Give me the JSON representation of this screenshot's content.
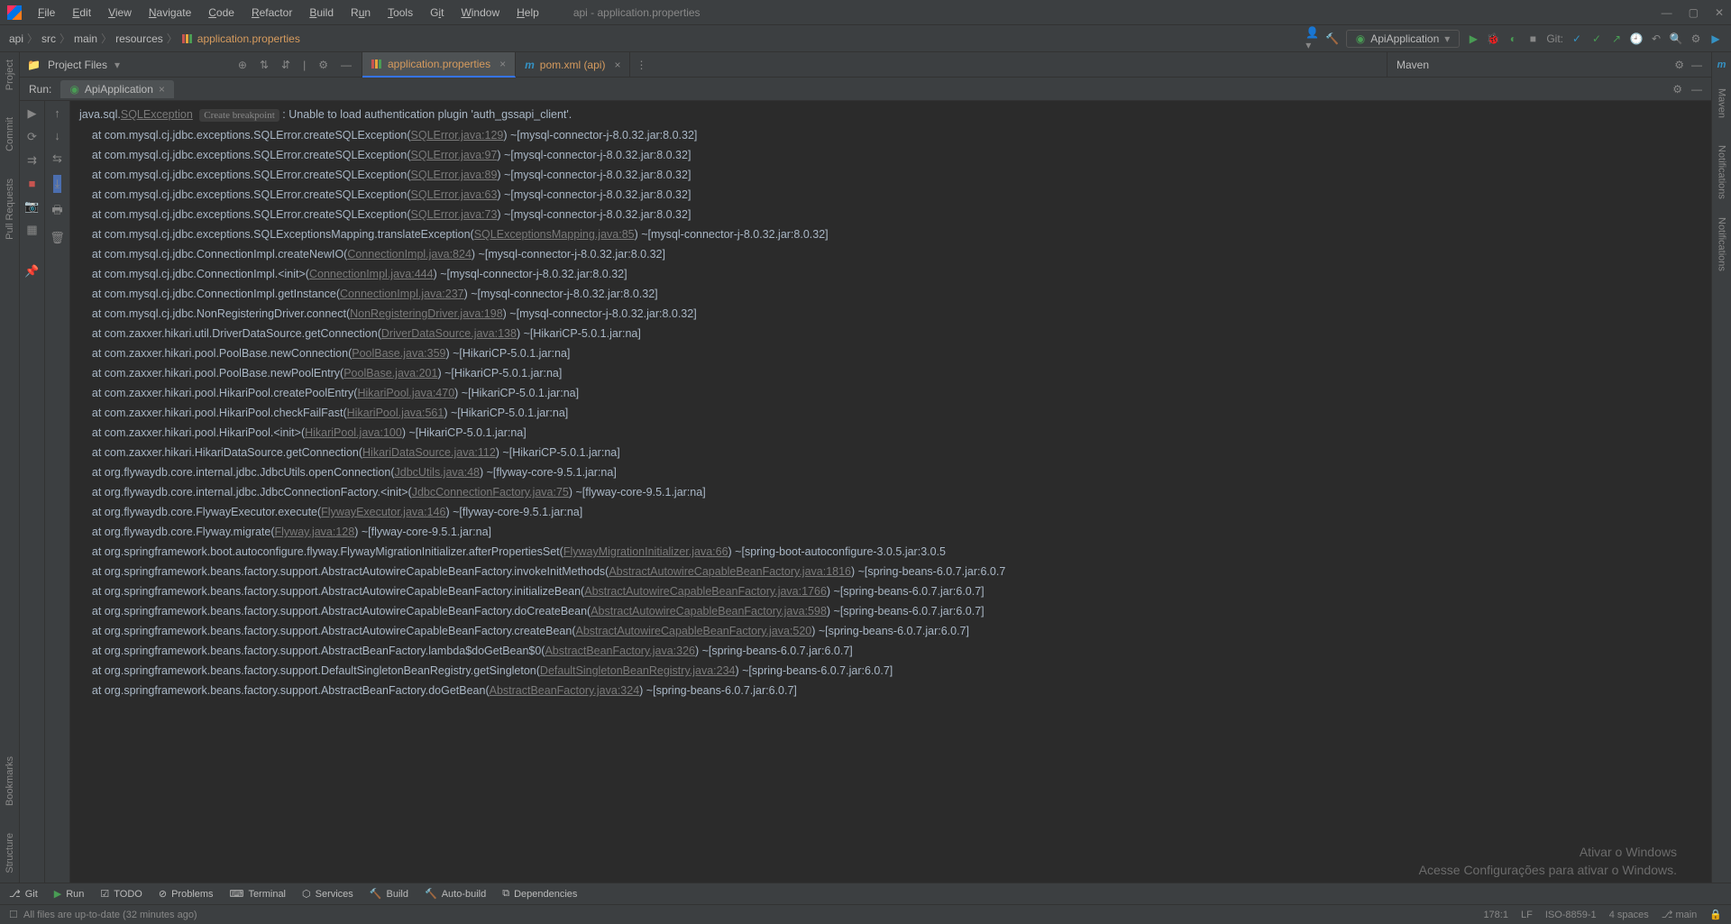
{
  "menu": [
    "File",
    "Edit",
    "View",
    "Navigate",
    "Code",
    "Refactor",
    "Build",
    "Run",
    "Tools",
    "Git",
    "Window",
    "Help"
  ],
  "title": "api - application.properties",
  "breadcrumb": {
    "p1": "api",
    "p2": "src",
    "p3": "main",
    "p4": "resources",
    "p5": "application.properties"
  },
  "runcfg": "ApiApplication",
  "git_label": "Git:",
  "proj_tool": "Project Files",
  "tabs": {
    "t1": "application.properties",
    "t2": "pom.xml (api)"
  },
  "maven": "Maven",
  "run_label": "Run:",
  "run_tab": "ApiApplication",
  "left_gutter": [
    "Project",
    "Commit",
    "Pull Requests",
    "Bookmarks",
    "Structure"
  ],
  "right_gutter": [
    "Maven",
    "Notifications"
  ],
  "breakpoint_hint": "Create breakpoint",
  "console_head": {
    "prefix": "java.sql.",
    "exc": "SQLException",
    "msg": " : Unable to load authentication plugin 'auth_gssapi_client'."
  },
  "stack": [
    {
      "pre": "    at com.mysql.cj.jdbc.exceptions.SQLError.createSQLException(",
      "link": "SQLError.java:129",
      "post": ") ~[mysql-connector-j-8.0.32.jar:8.0.32]"
    },
    {
      "pre": "    at com.mysql.cj.jdbc.exceptions.SQLError.createSQLException(",
      "link": "SQLError.java:97",
      "post": ") ~[mysql-connector-j-8.0.32.jar:8.0.32]"
    },
    {
      "pre": "    at com.mysql.cj.jdbc.exceptions.SQLError.createSQLException(",
      "link": "SQLError.java:89",
      "post": ") ~[mysql-connector-j-8.0.32.jar:8.0.32]"
    },
    {
      "pre": "    at com.mysql.cj.jdbc.exceptions.SQLError.createSQLException(",
      "link": "SQLError.java:63",
      "post": ") ~[mysql-connector-j-8.0.32.jar:8.0.32]"
    },
    {
      "pre": "    at com.mysql.cj.jdbc.exceptions.SQLError.createSQLException(",
      "link": "SQLError.java:73",
      "post": ") ~[mysql-connector-j-8.0.32.jar:8.0.32]"
    },
    {
      "pre": "    at com.mysql.cj.jdbc.exceptions.SQLExceptionsMapping.translateException(",
      "link": "SQLExceptionsMapping.java:85",
      "post": ") ~[mysql-connector-j-8.0.32.jar:8.0.32]"
    },
    {
      "pre": "    at com.mysql.cj.jdbc.ConnectionImpl.createNewIO(",
      "link": "ConnectionImpl.java:824",
      "post": ") ~[mysql-connector-j-8.0.32.jar:8.0.32]"
    },
    {
      "pre": "    at com.mysql.cj.jdbc.ConnectionImpl.<init>(",
      "link": "ConnectionImpl.java:444",
      "post": ") ~[mysql-connector-j-8.0.32.jar:8.0.32]"
    },
    {
      "pre": "    at com.mysql.cj.jdbc.ConnectionImpl.getInstance(",
      "link": "ConnectionImpl.java:237",
      "post": ") ~[mysql-connector-j-8.0.32.jar:8.0.32]"
    },
    {
      "pre": "    at com.mysql.cj.jdbc.NonRegisteringDriver.connect(",
      "link": "NonRegisteringDriver.java:198",
      "post": ") ~[mysql-connector-j-8.0.32.jar:8.0.32]"
    },
    {
      "pre": "    at com.zaxxer.hikari.util.DriverDataSource.getConnection(",
      "link": "DriverDataSource.java:138",
      "post": ") ~[HikariCP-5.0.1.jar:na]"
    },
    {
      "pre": "    at com.zaxxer.hikari.pool.PoolBase.newConnection(",
      "link": "PoolBase.java:359",
      "post": ") ~[HikariCP-5.0.1.jar:na]"
    },
    {
      "pre": "    at com.zaxxer.hikari.pool.PoolBase.newPoolEntry(",
      "link": "PoolBase.java:201",
      "post": ") ~[HikariCP-5.0.1.jar:na]"
    },
    {
      "pre": "    at com.zaxxer.hikari.pool.HikariPool.createPoolEntry(",
      "link": "HikariPool.java:470",
      "post": ") ~[HikariCP-5.0.1.jar:na]"
    },
    {
      "pre": "    at com.zaxxer.hikari.pool.HikariPool.checkFailFast(",
      "link": "HikariPool.java:561",
      "post": ") ~[HikariCP-5.0.1.jar:na]"
    },
    {
      "pre": "    at com.zaxxer.hikari.pool.HikariPool.<init>(",
      "link": "HikariPool.java:100",
      "post": ") ~[HikariCP-5.0.1.jar:na]"
    },
    {
      "pre": "    at com.zaxxer.hikari.HikariDataSource.getConnection(",
      "link": "HikariDataSource.java:112",
      "post": ") ~[HikariCP-5.0.1.jar:na]"
    },
    {
      "pre": "    at org.flywaydb.core.internal.jdbc.JdbcUtils.openConnection(",
      "link": "JdbcUtils.java:48",
      "post": ") ~[flyway-core-9.5.1.jar:na]"
    },
    {
      "pre": "    at org.flywaydb.core.internal.jdbc.JdbcConnectionFactory.<init>(",
      "link": "JdbcConnectionFactory.java:75",
      "post": ") ~[flyway-core-9.5.1.jar:na]"
    },
    {
      "pre": "    at org.flywaydb.core.FlywayExecutor.execute(",
      "link": "FlywayExecutor.java:146",
      "post": ") ~[flyway-core-9.5.1.jar:na]"
    },
    {
      "pre": "    at org.flywaydb.core.Flyway.migrate(",
      "link": "Flyway.java:128",
      "post": ") ~[flyway-core-9.5.1.jar:na]"
    },
    {
      "pre": "    at org.springframework.boot.autoconfigure.flyway.FlywayMigrationInitializer.afterPropertiesSet(",
      "link": "FlywayMigrationInitializer.java:66",
      "post": ") ~[spring-boot-autoconfigure-3.0.5.jar:3.0.5"
    },
    {
      "pre": "    at org.springframework.beans.factory.support.AbstractAutowireCapableBeanFactory.invokeInitMethods(",
      "link": "AbstractAutowireCapableBeanFactory.java:1816",
      "post": ") ~[spring-beans-6.0.7.jar:6.0.7"
    },
    {
      "pre": "    at org.springframework.beans.factory.support.AbstractAutowireCapableBeanFactory.initializeBean(",
      "link": "AbstractAutowireCapableBeanFactory.java:1766",
      "post": ") ~[spring-beans-6.0.7.jar:6.0.7]"
    },
    {
      "pre": "    at org.springframework.beans.factory.support.AbstractAutowireCapableBeanFactory.doCreateBean(",
      "link": "AbstractAutowireCapableBeanFactory.java:598",
      "post": ") ~[spring-beans-6.0.7.jar:6.0.7]"
    },
    {
      "pre": "    at org.springframework.beans.factory.support.AbstractAutowireCapableBeanFactory.createBean(",
      "link": "AbstractAutowireCapableBeanFactory.java:520",
      "post": ") ~[spring-beans-6.0.7.jar:6.0.7]"
    },
    {
      "pre": "    at org.springframework.beans.factory.support.AbstractBeanFactory.lambda$doGetBean$0(",
      "link": "AbstractBeanFactory.java:326",
      "post": ") ~[spring-beans-6.0.7.jar:6.0.7]"
    },
    {
      "pre": "    at org.springframework.beans.factory.support.DefaultSingletonBeanRegistry.getSingleton(",
      "link": "DefaultSingletonBeanRegistry.java:234",
      "post": ") ~[spring-beans-6.0.7.jar:6.0.7]"
    },
    {
      "pre": "    at org.springframework.beans.factory.support.AbstractBeanFactory.doGetBean(",
      "link": "AbstractBeanFactory.java:324",
      "post": ") ~[spring-beans-6.0.7.jar:6.0.7]"
    }
  ],
  "bottom": {
    "git": "Git",
    "run": "Run",
    "todo": "TODO",
    "problems": "Problems",
    "terminal": "Terminal",
    "services": "Services",
    "build": "Build",
    "autobuild": "Auto-build",
    "deps": "Dependencies"
  },
  "status": {
    "msg": "All files are up-to-date (32 minutes ago)",
    "pos": "178:1",
    "lf": "LF",
    "enc": "ISO-8859-1",
    "indent": "4 spaces",
    "branch": "main"
  },
  "watermark": {
    "l1": "Ativar o Windows",
    "l2": "Acesse Configurações para ativar o Windows."
  }
}
